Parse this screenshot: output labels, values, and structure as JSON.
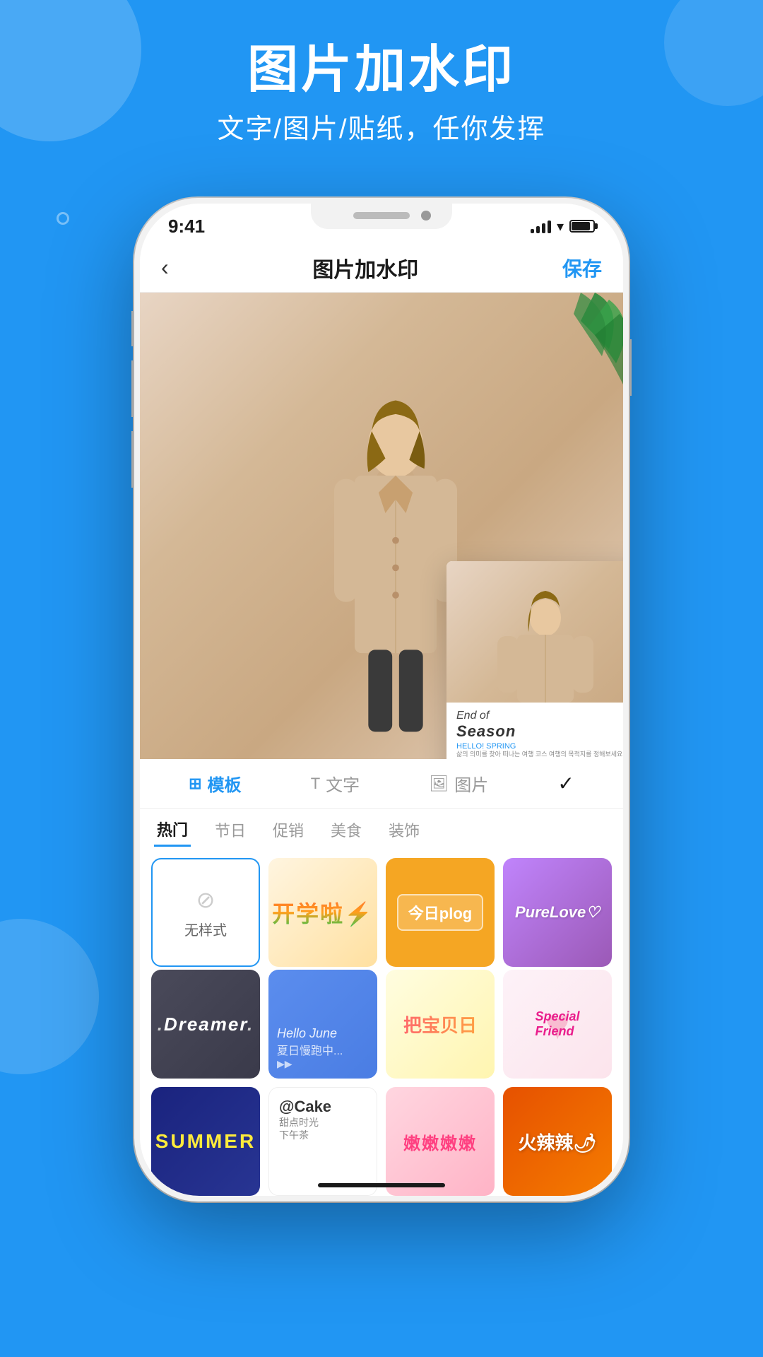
{
  "app": {
    "background_color": "#2196F3"
  },
  "header": {
    "title": "图片加水印",
    "subtitle": "文字/图片/贴纸，任你发挥"
  },
  "status_bar": {
    "time": "9:41"
  },
  "nav": {
    "back_label": "‹",
    "title": "图片加水印",
    "save_label": "保存"
  },
  "tabs": {
    "items": [
      {
        "icon": "grid-icon",
        "label": "模板",
        "active": true
      },
      {
        "icon": "text-icon",
        "label": "T 文字",
        "active": false
      },
      {
        "icon": "image-icon",
        "label": "图片",
        "active": false
      },
      {
        "icon": "check-icon",
        "label": "",
        "active": false
      }
    ]
  },
  "categories": {
    "items": [
      {
        "label": "热门",
        "active": true
      },
      {
        "label": "节日",
        "active": false
      },
      {
        "label": "促销",
        "active": false
      },
      {
        "label": "美食",
        "active": false
      },
      {
        "label": "装饰",
        "active": false
      }
    ]
  },
  "watermark_card": {
    "line1": "End of",
    "line2": "Season",
    "line3": "HELLO! SPRING",
    "line4": "삶의 의미를 찾아 떠나는 여행 코스\n여행의 목적지를 정해보세요"
  },
  "templates": [
    {
      "id": "no-style",
      "label": "无样式",
      "type": "no-style"
    },
    {
      "id": "school",
      "label": "开学啦",
      "type": "school"
    },
    {
      "id": "plog",
      "label": "今日plog",
      "type": "plog"
    },
    {
      "id": "love",
      "label": "PureLove",
      "type": "love"
    },
    {
      "id": "dreamer",
      "label": "Dreamer",
      "type": "dreamer"
    },
    {
      "id": "june",
      "label": "Hello June",
      "type": "june"
    },
    {
      "id": "baby",
      "label": "把宝贝日",
      "type": "baby"
    },
    {
      "id": "friend",
      "label": "Special Friend",
      "type": "friend"
    },
    {
      "id": "summer",
      "label": "SUMMER",
      "type": "summer"
    },
    {
      "id": "cake",
      "label": "@Cake",
      "type": "cake"
    },
    {
      "id": "nen",
      "label": "嫩嫩嫩嫩",
      "type": "nen"
    },
    {
      "id": "hot",
      "label": "火辣辣",
      "type": "hot"
    }
  ]
}
